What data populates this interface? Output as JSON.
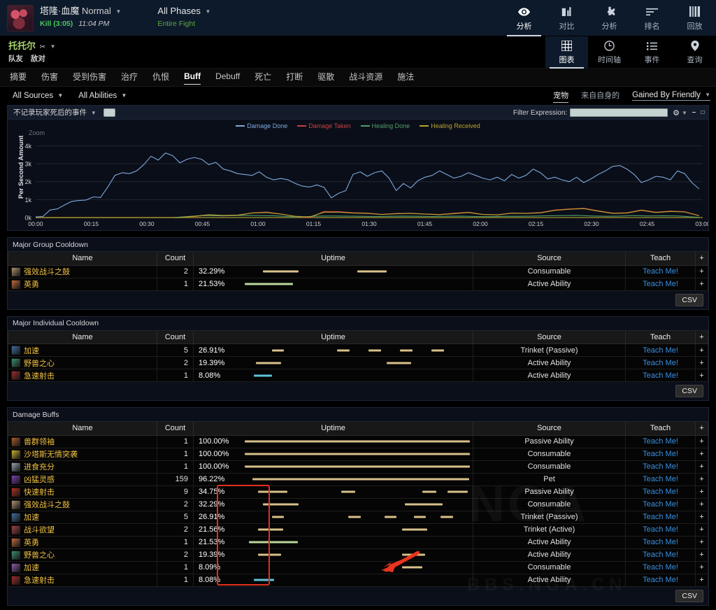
{
  "header": {
    "boss_name": "塔隆·血魔",
    "difficulty": "Normal",
    "result": "Kill (3:05)",
    "clock": "11:04 PM",
    "phase_title": "All Phases",
    "phase_sub": "Entire Fight",
    "nav": [
      {
        "label": "分析",
        "icon": "eye-icon",
        "active": true
      },
      {
        "label": "对比",
        "icon": "compare-icon",
        "active": false
      },
      {
        "label": "分析",
        "icon": "puzzle-icon",
        "active": false
      },
      {
        "label": "排名",
        "icon": "ranking-icon",
        "active": false
      },
      {
        "label": "回放",
        "icon": "replay-icon",
        "active": false
      }
    ]
  },
  "subheader": {
    "player_name": "托托尔",
    "player_class_icon": "✂",
    "friendly": "队友",
    "enemy": "敌对",
    "nav": [
      {
        "label": "图表",
        "icon": "grid-icon",
        "active": true
      },
      {
        "label": "时间轴",
        "icon": "clock-icon",
        "active": false
      },
      {
        "label": "事件",
        "icon": "list-icon",
        "active": false
      },
      {
        "label": "查询",
        "icon": "pin-icon",
        "active": false
      }
    ]
  },
  "tabs": [
    {
      "label": "摘要",
      "active": false
    },
    {
      "label": "伤害",
      "active": false
    },
    {
      "label": "受到伤害",
      "active": false
    },
    {
      "label": "治疗",
      "active": false
    },
    {
      "label": "仇恨",
      "active": false
    },
    {
      "label": "Buff",
      "active": true
    },
    {
      "label": "Debuff",
      "active": false
    },
    {
      "label": "死亡",
      "active": false
    },
    {
      "label": "打断",
      "active": false
    },
    {
      "label": "驱散",
      "active": false
    },
    {
      "label": "战斗资源",
      "active": false
    },
    {
      "label": "施法",
      "active": false
    }
  ],
  "filters": {
    "sources": "All Sources",
    "abilities": "All Abilities",
    "right": [
      {
        "label": "宠物",
        "active": true
      },
      {
        "label": "来自自身的",
        "active": false
      }
    ],
    "gained_by": "Gained By Friendly"
  },
  "chart_toolbar": {
    "dead_events": "不记录玩家死后的事件",
    "checkbox_checked": false,
    "filter_expression_label": "Filter Expression:",
    "filter_expression_value": "",
    "filter_expression_placeholder": "",
    "gear_icon": "gear-icon",
    "minimize_icon": "minimize-icon",
    "maximize_icon": "maximize-icon"
  },
  "chart_data": {
    "type": "line",
    "title": "",
    "zoom_label": "Zoom",
    "ylabel": "Per Second Amount",
    "xlabel": "",
    "grid": true,
    "legend_position": "top-center",
    "ylim": [
      0,
      4600
    ],
    "yticks": [
      "0k",
      "1k",
      "2k",
      "3k",
      "4k"
    ],
    "ytick_values": [
      0,
      1000,
      2000,
      3000,
      4000
    ],
    "xticks": [
      "00:00",
      "00:15",
      "00:30",
      "00:45",
      "01:00",
      "01:15",
      "01:30",
      "01:45",
      "02:00",
      "02:15",
      "02:30",
      "02:45",
      "03:00"
    ],
    "xlim": [
      0,
      185
    ],
    "series": [
      {
        "name": "Damage Done",
        "color": "#7ea8dd",
        "x": [
          0,
          2,
          4,
          6,
          8,
          10,
          12,
          14,
          16,
          18,
          20,
          22,
          24,
          26,
          28,
          30,
          32,
          34,
          36,
          38,
          40,
          42,
          44,
          46,
          48,
          50,
          52,
          54,
          56,
          58,
          60,
          62,
          64,
          66,
          68,
          70,
          72,
          74,
          76,
          78,
          80,
          82,
          84,
          86,
          88,
          90,
          92,
          94,
          96,
          98,
          100,
          102,
          104,
          106,
          108,
          110,
          112,
          114,
          116,
          118,
          120,
          122,
          124,
          126,
          128,
          130,
          132,
          134,
          136,
          138,
          140,
          142,
          144,
          146,
          148,
          150,
          152,
          154,
          156,
          158,
          160,
          162,
          164,
          166,
          168,
          170,
          172,
          174,
          176,
          178,
          180,
          182,
          184
        ],
        "values": [
          40,
          60,
          420,
          480,
          700,
          900,
          950,
          980,
          1150,
          1120,
          1700,
          2350,
          2500,
          2450,
          2600,
          2950,
          3420,
          3200,
          3600,
          3450,
          3050,
          3250,
          3350,
          3250,
          2950,
          3080,
          2700,
          2600,
          2450,
          2400,
          2350,
          2550,
          2250,
          2100,
          2180,
          2100,
          1900,
          1750,
          1700,
          1820,
          1680,
          1100,
          1350,
          1500,
          2400,
          2550,
          2300,
          2500,
          2600,
          2200,
          1500,
          1900,
          1650,
          2050,
          2250,
          2350,
          2600,
          2400,
          2200,
          2300,
          2500,
          2350,
          2200,
          2100,
          2250,
          2050,
          2400,
          2200,
          2350,
          2700,
          2500,
          2150,
          2250,
          2100,
          2000,
          2250,
          1950,
          2150,
          2400,
          2600,
          2850,
          2900,
          2700,
          2400,
          1950,
          2100,
          2300,
          2250,
          2100,
          2600,
          2450,
          1950,
          1600
        ]
      },
      {
        "name": "Damage Taken",
        "color": "#c94040",
        "x": [
          0,
          40,
          44,
          48,
          52,
          56,
          60,
          64,
          68,
          72,
          76,
          80,
          84,
          88,
          92,
          96,
          100,
          104,
          108,
          112,
          116,
          120,
          124,
          128,
          132,
          136,
          140,
          144,
          148,
          152,
          156,
          160,
          164,
          168,
          172,
          176,
          180,
          184
        ],
        "values": [
          0,
          0,
          60,
          130,
          90,
          120,
          260,
          310,
          200,
          60,
          0,
          340,
          330,
          270,
          250,
          180,
          230,
          240,
          200,
          170,
          240,
          300,
          180,
          160,
          250,
          240,
          280,
          420,
          480,
          520,
          380,
          250,
          270,
          420,
          300,
          360,
          330,
          110
        ]
      },
      {
        "name": "Healing Done",
        "color": "#4f9e6a",
        "x": [
          0,
          38,
          42,
          46,
          50,
          54,
          58,
          62,
          66,
          70,
          74,
          78,
          82,
          86,
          90,
          94,
          98,
          102,
          106,
          110,
          114,
          118,
          122,
          126,
          130,
          134,
          138,
          142,
          146,
          150,
          154,
          158,
          162,
          166,
          170,
          174,
          178,
          182,
          184
        ],
        "values": [
          0,
          0,
          60,
          110,
          100,
          110,
          120,
          110,
          100,
          60,
          40,
          80,
          90,
          80,
          70,
          60,
          70,
          80,
          70,
          60,
          70,
          80,
          60,
          50,
          70,
          70,
          80,
          100,
          110,
          120,
          90,
          70,
          80,
          110,
          90,
          100,
          90,
          40,
          20
        ]
      },
      {
        "name": "Healing Received",
        "color": "#b8a12e",
        "x": [
          0,
          40,
          44,
          48,
          52,
          56,
          60,
          64,
          68,
          72,
          76,
          80,
          84,
          88,
          92,
          96,
          100,
          104,
          108,
          112,
          116,
          120,
          124,
          128,
          132,
          136,
          140,
          144,
          148,
          152,
          156,
          160,
          164,
          168,
          172,
          176,
          180,
          184
        ],
        "values": [
          0,
          0,
          70,
          160,
          120,
          140,
          250,
          280,
          190,
          70,
          30,
          300,
          300,
          250,
          230,
          170,
          210,
          230,
          190,
          160,
          220,
          280,
          170,
          150,
          240,
          230,
          260,
          400,
          460,
          500,
          360,
          230,
          250,
          400,
          280,
          340,
          310,
          100
        ]
      }
    ]
  },
  "tables": [
    {
      "title": "Major Group Cooldown",
      "headers": {
        "name": "Name",
        "count": "Count",
        "uptime": "Uptime",
        "source": "Source",
        "teach": "Teach",
        "plus": "+"
      },
      "csv_label": "CSV",
      "rows": [
        {
          "name": "强效战斗之鼓",
          "icon_color": "#b09070",
          "count": "2",
          "pct": "32.29%",
          "bar_color": "#d8c08a",
          "segments": [
            [
              8,
              16
            ],
            [
              50,
              13
            ]
          ],
          "source": "Consumable",
          "teach": "Teach Me!",
          "plus": "+"
        },
        {
          "name": "英勇",
          "icon_color": "#c06a3a",
          "count": "1",
          "pct": "21.53%",
          "bar_color": "#b9d79a",
          "segments": [
            [
              0,
              21.5
            ]
          ],
          "source": "Active Ability",
          "teach": "Teach Me!",
          "plus": "+"
        }
      ]
    },
    {
      "title": "Major Individual Cooldown",
      "headers": {
        "name": "Name",
        "count": "Count",
        "uptime": "Uptime",
        "source": "Source",
        "teach": "Teach",
        "plus": "+"
      },
      "csv_label": "CSV",
      "rows": [
        {
          "name": "加速",
          "icon_color": "#3f6d9e",
          "count": "5",
          "pct": "26.91%",
          "bar_color": "#d8c08a",
          "segments": [
            [
              12,
              5.5
            ],
            [
              41,
              5.5
            ],
            [
              55,
              5.5
            ],
            [
              69,
              5.5
            ],
            [
              83,
              5.5
            ]
          ],
          "source": "Trinket (Passive)",
          "teach": "Teach Me!",
          "plus": "+"
        },
        {
          "name": "野兽之心",
          "icon_color": "#3c8e6e",
          "count": "2",
          "pct": "19.39%",
          "bar_color": "#d8c08a",
          "segments": [
            [
              5,
              11
            ],
            [
              63,
              11
            ]
          ],
          "source": "Active Ability",
          "teach": "Teach Me!",
          "plus": "+"
        },
        {
          "name": "急速射击",
          "icon_color": "#9e2a2a",
          "count": "1",
          "pct": "8.08%",
          "bar_color": "#5ec2d8",
          "segments": [
            [
              4,
              8
            ]
          ],
          "source": "Active Ability",
          "teach": "Teach Me!",
          "plus": "+"
        }
      ]
    },
    {
      "title": "Damage Buffs",
      "headers": {
        "name": "Name",
        "count": "Count",
        "uptime": "Uptime",
        "source": "Source",
        "teach": "Teach",
        "plus": "+"
      },
      "csv_label": "CSV",
      "rows": [
        {
          "name": "兽群领袖",
          "icon_color": "#a85c28",
          "count": "1",
          "pct": "100.00%",
          "bar_color": "#d8c08a",
          "segments": [
            [
              0,
              100
            ]
          ],
          "source": "Passive Ability",
          "teach": "Teach Me!",
          "plus": "+"
        },
        {
          "name": "沙塔斯无情突袭",
          "icon_color": "#c8b030",
          "count": "1",
          "pct": "100.00%",
          "bar_color": "#d8c08a",
          "segments": [
            [
              0,
              100
            ]
          ],
          "source": "Consumable",
          "teach": "Teach Me!",
          "plus": "+"
        },
        {
          "name": "进食充分",
          "icon_color": "#9aa4b0",
          "count": "1",
          "pct": "100.00%",
          "bar_color": "#d8c08a",
          "segments": [
            [
              0,
              100
            ]
          ],
          "source": "Consumable",
          "teach": "Teach Me!",
          "plus": "+"
        },
        {
          "name": "凶猛灵感",
          "icon_color": "#7a3eb0",
          "count": "159",
          "pct": "96.22%",
          "bar_color": "#d8c08a",
          "segments": [
            [
              3.5,
              96.2
            ]
          ],
          "source": "Pet",
          "teach": "Teach Me!",
          "plus": "+"
        },
        {
          "name": "快速射击",
          "icon_color": "#b03020",
          "count": "9",
          "pct": "34.75%",
          "bar_color": "#d8c08a",
          "segments": [
            [
              6,
              13
            ],
            [
              43,
              6
            ],
            [
              79,
              6
            ],
            [
              90,
              9
            ]
          ],
          "source": "Passive Ability",
          "teach": "Teach Me!",
          "plus": "+"
        },
        {
          "name": "强效战斗之鼓",
          "icon_color": "#b09070",
          "count": "2",
          "pct": "32.29%",
          "bar_color": "#d8c08a",
          "segments": [
            [
              8,
              16
            ],
            [
              71,
              17
            ]
          ],
          "source": "Consumable",
          "teach": "Teach Me!",
          "plus": "+"
        },
        {
          "name": "加速",
          "icon_color": "#3f6d9e",
          "count": "5",
          "pct": "26.91%",
          "bar_color": "#d8c08a",
          "segments": [
            [
              12,
              5.5
            ],
            [
              46,
              5.5
            ],
            [
              62,
              5.5
            ],
            [
              75,
              5.5
            ],
            [
              87,
              5.5
            ]
          ],
          "source": "Trinket (Passive)",
          "teach": "Teach Me!",
          "plus": "+"
        },
        {
          "name": "战斗欲望",
          "icon_color": "#a04048",
          "count": "2",
          "pct": "21.56%",
          "bar_color": "#d8c08a",
          "segments": [
            [
              6,
              11
            ],
            [
              70,
              11
            ]
          ],
          "source": "Trinket (Active)",
          "teach": "Teach Me!",
          "plus": "+"
        },
        {
          "name": "英勇",
          "icon_color": "#c06a3a",
          "count": "1",
          "pct": "21.53%",
          "bar_color": "#b9d79a",
          "segments": [
            [
              2,
              21.5
            ]
          ],
          "source": "Active Ability",
          "teach": "Teach Me!",
          "plus": "+"
        },
        {
          "name": "野兽之心",
          "icon_color": "#3c8e6e",
          "count": "2",
          "pct": "19.39%",
          "bar_color": "#d8c08a",
          "segments": [
            [
              6,
              10
            ],
            [
              70,
              10
            ]
          ],
          "source": "Active Ability",
          "teach": "Teach Me!",
          "plus": "+"
        },
        {
          "name": "加速",
          "icon_color": "#8a5aa8",
          "count": "1",
          "pct": "8.09%",
          "bar_color": "#d8c08a",
          "segments": [
            [
              70,
              9
            ]
          ],
          "source": "Consumable",
          "teach": "Teach Me!",
          "plus": "+"
        },
        {
          "name": "急速射击",
          "icon_color": "#9e2a2a",
          "count": "1",
          "pct": "8.08%",
          "bar_color": "#5ec2d8",
          "segments": [
            [
              4,
              9
            ]
          ],
          "source": "Active Ability",
          "teach": "Teach Me!",
          "plus": "+"
        }
      ]
    }
  ],
  "watermark": {
    "brand": "NGA",
    "url": "BBS.NGA.CN"
  },
  "annotation": {
    "box_color": "#e03020",
    "arrow_color": "#e8351f"
  }
}
